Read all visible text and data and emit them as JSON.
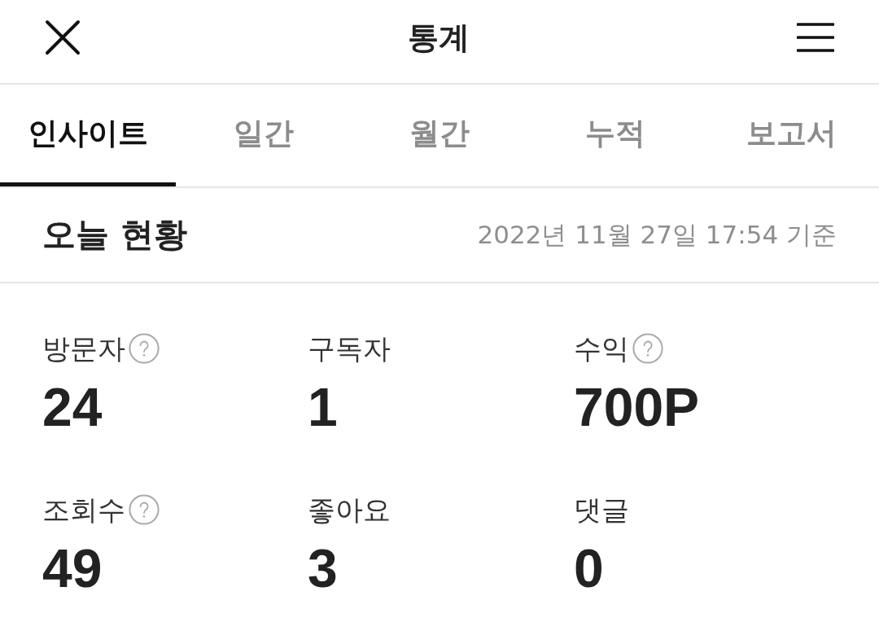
{
  "header": {
    "title": "통계"
  },
  "tabs": [
    {
      "label": "인사이트",
      "selected": true
    },
    {
      "label": "일간",
      "selected": false
    },
    {
      "label": "월간",
      "selected": false
    },
    {
      "label": "누적",
      "selected": false
    },
    {
      "label": "보고서",
      "selected": false
    }
  ],
  "section": {
    "title": "오늘 현황",
    "timestamp": "2022년 11월 27일 17:54 기준"
  },
  "stats": [
    {
      "label": "방문자",
      "value": "24",
      "help": true
    },
    {
      "label": "구독자",
      "value": "1",
      "help": false
    },
    {
      "label": "수익",
      "value": "700P",
      "help": true
    },
    {
      "label": "조회수",
      "value": "49",
      "help": true
    },
    {
      "label": "좋아요",
      "value": "3",
      "help": false
    },
    {
      "label": "댓글",
      "value": "0",
      "help": false
    }
  ]
}
